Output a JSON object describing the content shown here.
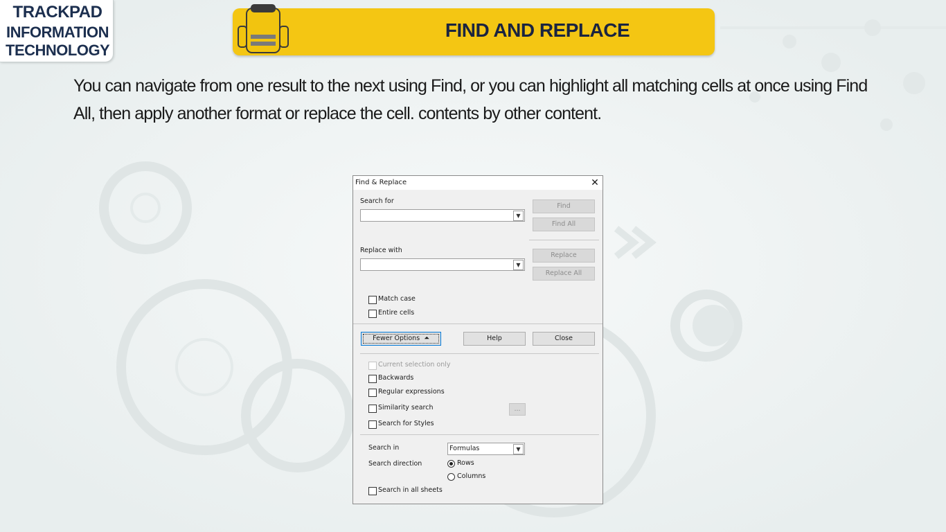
{
  "logo": {
    "line1": "TRACKPAD",
    "line2": "INFORMATION",
    "line3": "TECHNOLOGY",
    "color": "#1c2f4f"
  },
  "banner": {
    "title": "FIND AND REPLACE",
    "color": "#f4c613"
  },
  "body_text": "You can navigate from one result to the next using Find, or you can highlight all matching cells at once using Find All, then apply another format or replace the cell. contents by other content.",
  "dialog": {
    "title": "Find & Replace",
    "close_icon": "close-icon",
    "search_for_label": "Search for",
    "search_for_value": "",
    "replace_with_label": "Replace with",
    "replace_with_value": "",
    "find_button": "Find",
    "find_all_button": "Find All",
    "replace_button": "Replace",
    "replace_all_button": "Replace All",
    "match_case": "Match case",
    "entire_cells": "Entire cells",
    "fewer_options_button": "Fewer Options",
    "help_button": "Help",
    "close_button": "Close",
    "current_selection_only": "Current selection only",
    "backwards": "Backwards",
    "regular_expressions": "Regular expressions",
    "similarity_search": "Similarity search",
    "similarity_options_button": "...",
    "search_for_styles": "Search for Styles",
    "search_in_label": "Search in",
    "search_in_value": "Formulas",
    "search_direction_label": "Search direction",
    "direction_rows": "Rows",
    "direction_columns": "Columns",
    "search_in_all_sheets": "Search in all sheets"
  }
}
